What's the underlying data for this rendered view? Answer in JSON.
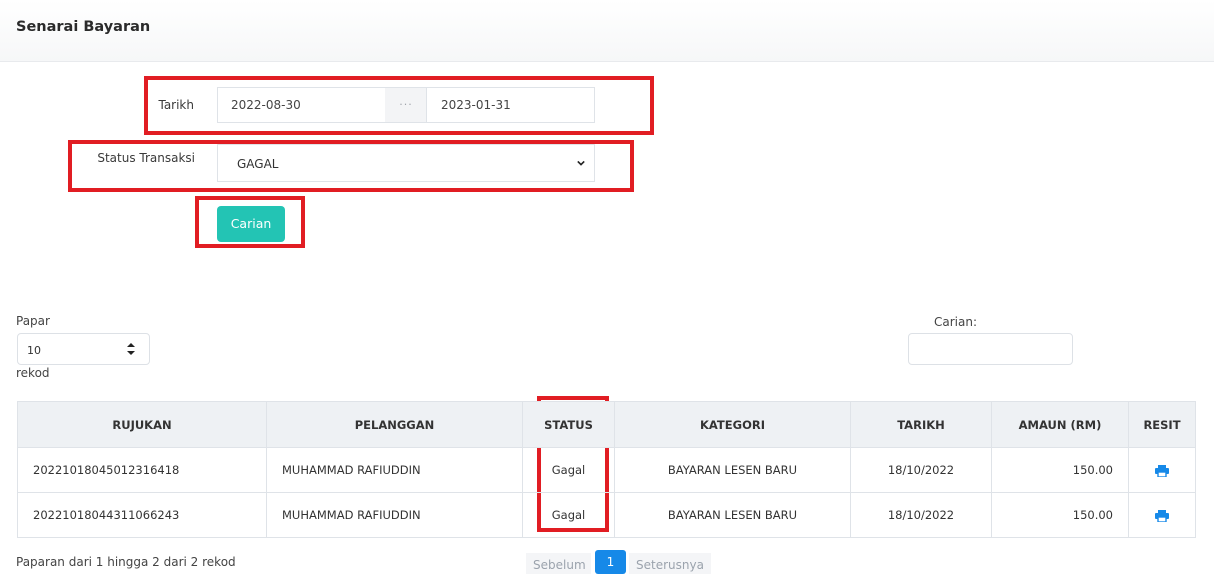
{
  "page": {
    "title": "Senarai Bayaran"
  },
  "filters": {
    "tarikh_label": "Tarikh",
    "date_from": "2022-08-30",
    "date_separator": "···",
    "date_to": "2023-01-31",
    "status_label": "Status Transaksi",
    "status_value": "GAGAL",
    "search_button": "Carian"
  },
  "table_controls": {
    "show_label": "Papar",
    "length_value": "10",
    "records_label": "rekod",
    "search_label": "Carian:"
  },
  "table": {
    "columns": [
      "RUJUKAN",
      "PELANGGAN",
      "STATUS",
      "KATEGORI",
      "TARIKH",
      "AMAUN (RM)",
      "RESIT"
    ],
    "rows": [
      {
        "rujukan": "20221018045012316418",
        "pelanggan": "MUHAMMAD RAFIUDDIN",
        "status": "Gagal",
        "kategori": "BAYARAN LESEN BARU",
        "tarikh": "18/10/2022",
        "amaun": "150.00",
        "resit_icon": "print-icon"
      },
      {
        "rujukan": "20221018044311066243",
        "pelanggan": "MUHAMMAD RAFIUDDIN",
        "status": "Gagal",
        "kategori": "BAYARAN LESEN BARU",
        "tarikh": "18/10/2022",
        "amaun": "150.00",
        "resit_icon": "print-icon"
      }
    ]
  },
  "footer": {
    "info": "Paparan dari 1 hingga 2 dari 2 rekod",
    "prev": "Sebelum",
    "page": "1",
    "next": "Seterusnya"
  },
  "colors": {
    "accent": "#23c4b4",
    "highlight": "#e11d23",
    "status_fail": "#e02424",
    "pager_active": "#1689e8"
  }
}
